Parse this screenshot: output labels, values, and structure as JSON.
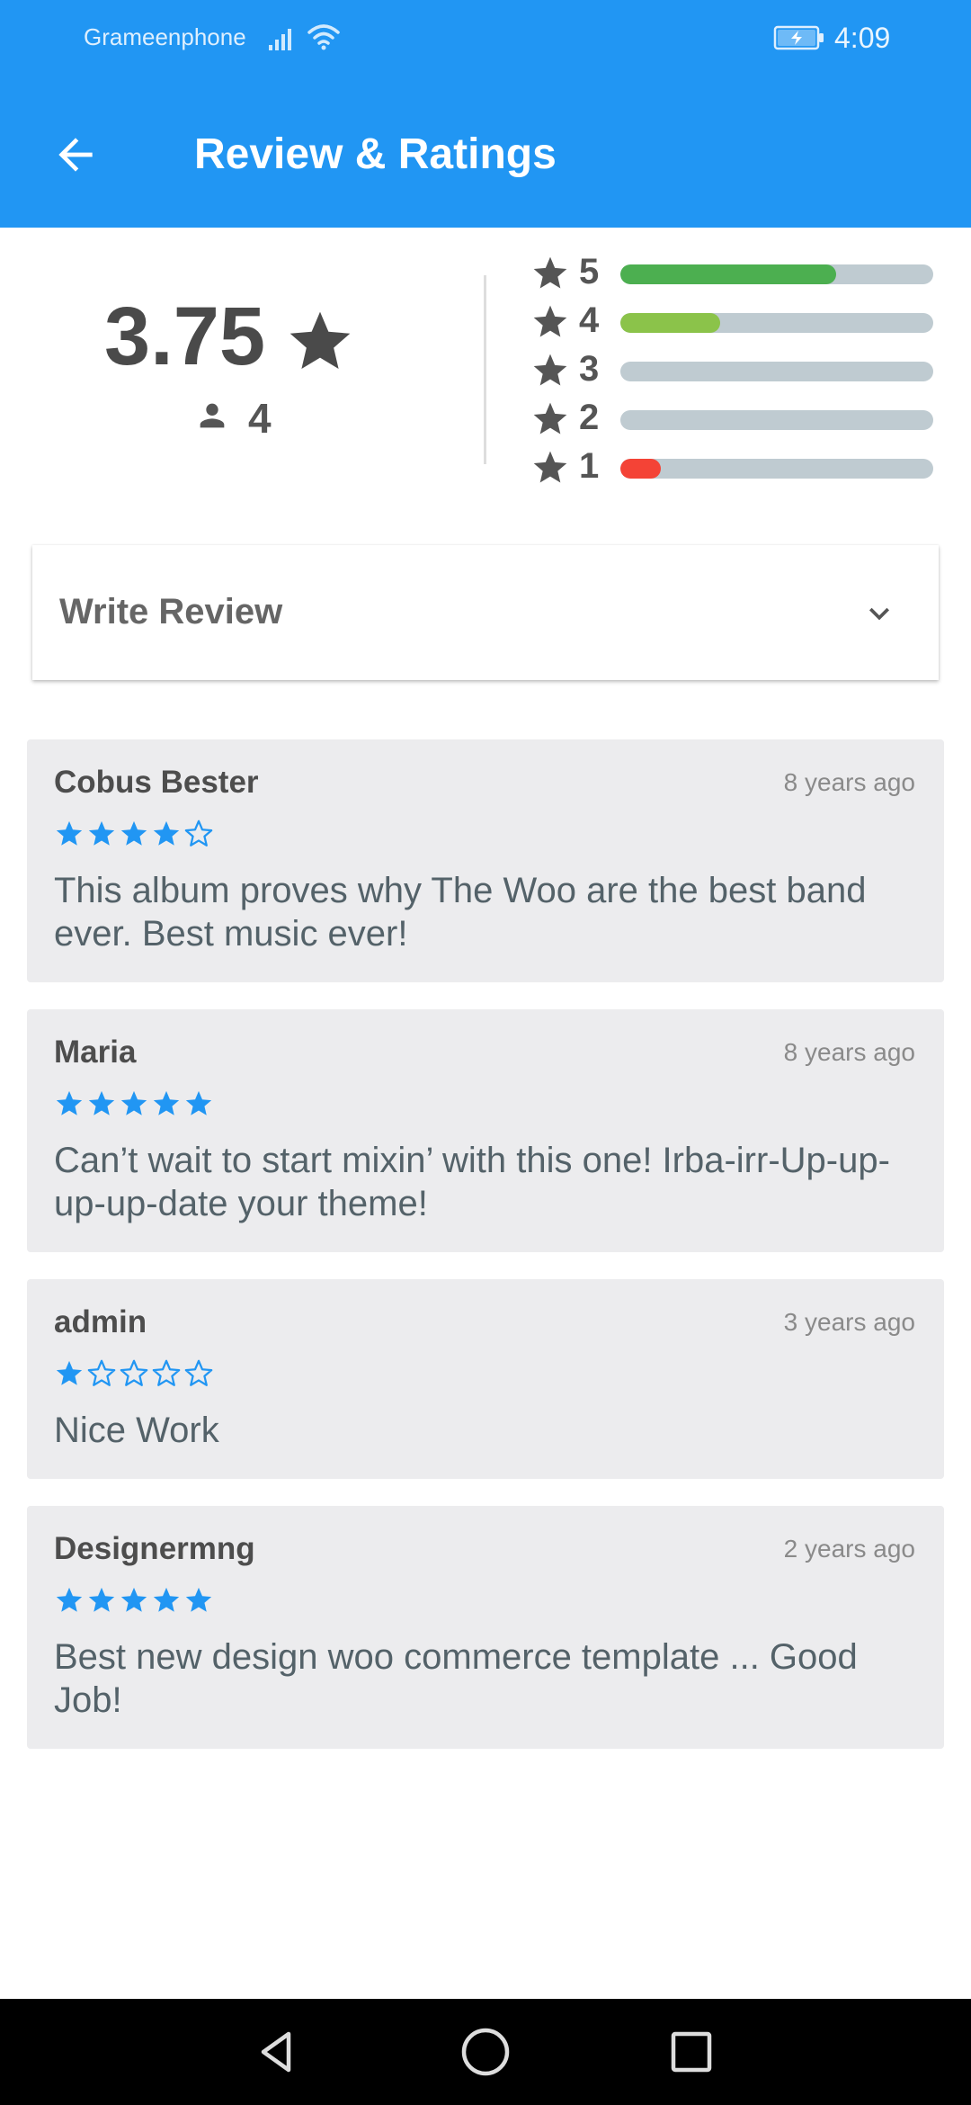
{
  "status_bar": {
    "carrier": "Grameenphone",
    "time": "4:09",
    "icons": [
      "signal-icon",
      "wifi-icon",
      "battery-charging-icon"
    ]
  },
  "toolbar": {
    "title": "Review & Ratings",
    "back_icon": "arrow-back-icon"
  },
  "summary": {
    "average": "3.75",
    "count": "4",
    "distribution": [
      {
        "star": "5",
        "fraction": 0.69,
        "color": "#4CAF50"
      },
      {
        "star": "4",
        "fraction": 0.32,
        "color": "#8BC34A"
      },
      {
        "star": "3",
        "fraction": 0.0,
        "color": "#CDDC39"
      },
      {
        "star": "2",
        "fraction": 0.0,
        "color": "#FF9800"
      },
      {
        "star": "1",
        "fraction": 0.13,
        "color": "#F44336"
      }
    ]
  },
  "write_review": {
    "label": "Write Review",
    "icon": "chevron-down-icon"
  },
  "reviews": [
    {
      "name": "Cobus Bester",
      "time": "8 years ago",
      "rating": 4,
      "text": "This album proves why The Woo are the best band ever. Best music ever!"
    },
    {
      "name": "Maria",
      "time": "8 years ago",
      "rating": 5,
      "text": "Can’t wait to start mixin’ with this one! Irba-irr-Up-up-up-up-date your theme!"
    },
    {
      "name": "admin",
      "time": "3 years ago",
      "rating": 1,
      "text": "Nice Work"
    },
    {
      "name": "Designermng",
      "time": "2 years ago",
      "rating": 5,
      "text": "Best new design woo commerce template ... Good Job!"
    }
  ],
  "colors": {
    "primary": "#2196F3",
    "star_blue": "#2196F3",
    "card_bg": "#ECECEE"
  },
  "navbar": {
    "icons": [
      "back-triangle-icon",
      "home-circle-icon",
      "recents-square-icon"
    ]
  }
}
